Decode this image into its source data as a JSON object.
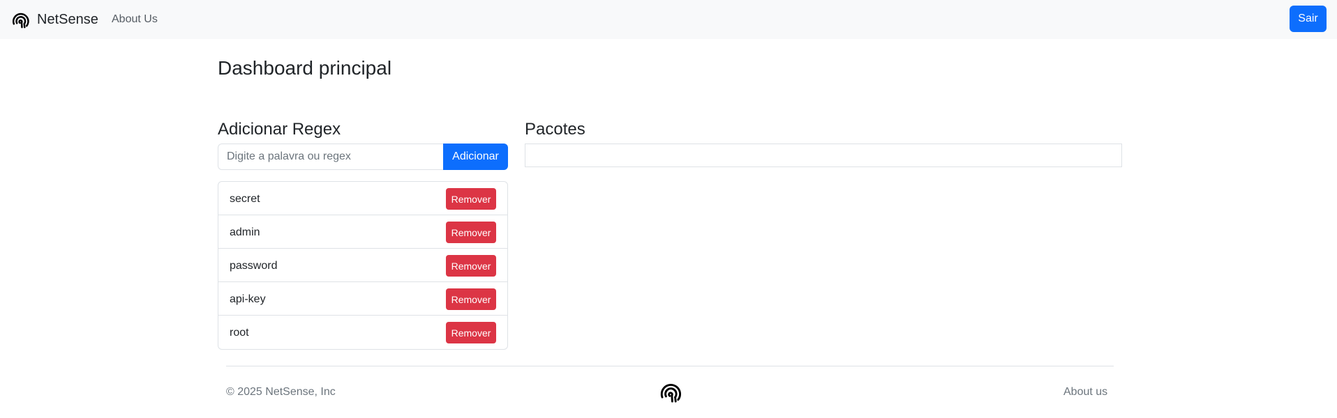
{
  "navbar": {
    "brand": "NetSense",
    "about_link": "About Us",
    "logout_button": "Sair"
  },
  "page": {
    "title": "Dashboard principal"
  },
  "regex_panel": {
    "heading": "Adicionar Regex",
    "input_placeholder": "Digite a palavra ou regex",
    "input_value": "",
    "add_button": "Adicionar",
    "remove_label": "Remover",
    "items": [
      "secret",
      "admin",
      "password",
      "api-key",
      "root"
    ]
  },
  "packets_panel": {
    "heading": "Pacotes"
  },
  "footer": {
    "copyright": "© 2025 NetSense, Inc",
    "about_link": "About us"
  },
  "colors": {
    "primary": "#0d6efd",
    "danger": "#dc3545",
    "navbar_bg": "#f8f9fa"
  },
  "icons": {
    "brand_logo": "fingerprint-icon",
    "footer_logo": "fingerprint-icon"
  }
}
